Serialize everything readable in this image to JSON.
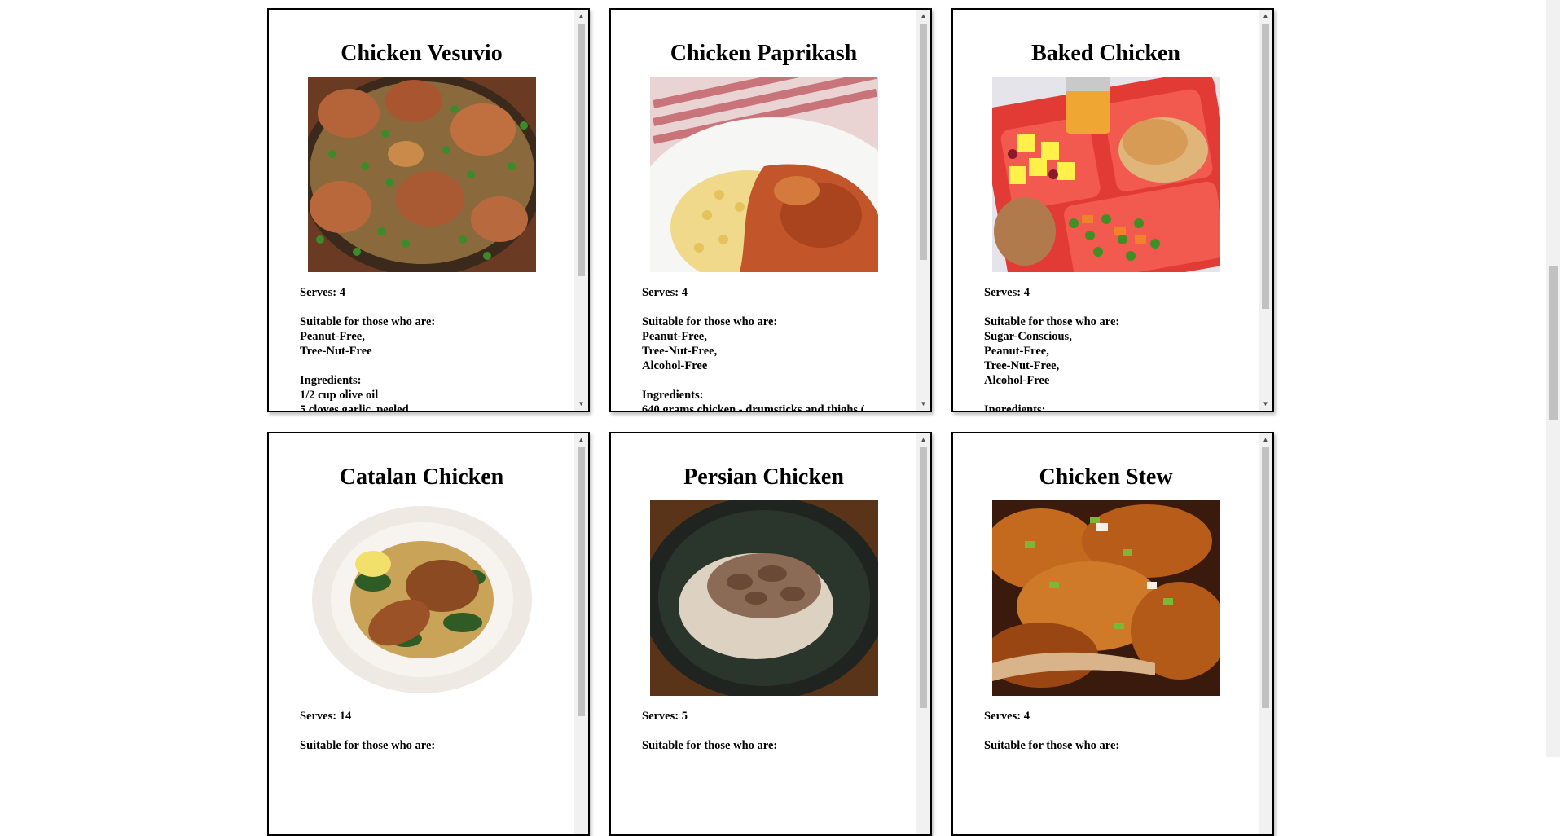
{
  "recipes": [
    {
      "title": "Chicken Vesuvio",
      "image_subject": "chicken-vesuvio-photo",
      "serves": "Serves: 4",
      "suitable_heading": "Suitable for those who are:",
      "suitable": [
        "Peanut-Free,",
        "Tree-Nut-Free"
      ],
      "ingredients_heading": "Ingredients:",
      "ingredients": [
        "1/2 cup olive oil",
        "5 cloves garlic, peeled"
      ]
    },
    {
      "title": "Chicken Paprikash",
      "image_subject": "chicken-paprikash-photo",
      "serves": "Serves: 4",
      "suitable_heading": "Suitable for those who are:",
      "suitable": [
        "Peanut-Free,",
        "Tree-Nut-Free,",
        "Alcohol-Free"
      ],
      "ingredients_heading": "Ingredients:",
      "ingredients": [
        "640 grams chicken - drumsticks and thighs ("
      ]
    },
    {
      "title": "Baked Chicken",
      "image_subject": "baked-chicken-tray-photo",
      "serves": "Serves: 4",
      "suitable_heading": "Suitable for those who are:",
      "suitable": [
        "Sugar-Conscious,",
        "Peanut-Free,",
        "Tree-Nut-Free,",
        "Alcohol-Free"
      ],
      "ingredients_heading": "Ingredients:",
      "ingredients": []
    },
    {
      "title": "Catalan Chicken",
      "image_subject": "catalan-chicken-photo",
      "serves": "Serves: 14",
      "suitable_heading": "Suitable for those who are:",
      "suitable": [],
      "ingredients_heading": "",
      "ingredients": []
    },
    {
      "title": "Persian Chicken",
      "image_subject": "persian-chicken-photo",
      "serves": "Serves: 5",
      "suitable_heading": "Suitable for those who are:",
      "suitable": [],
      "ingredients_heading": "",
      "ingredients": []
    },
    {
      "title": "Chicken Stew",
      "image_subject": "chicken-stew-photo",
      "serves": "Serves: 4",
      "suitable_heading": "Suitable for those who are:",
      "suitable": [],
      "ingredients_heading": "",
      "ingredients": []
    }
  ],
  "icons": {
    "scroll_up": "scroll-up-arrow-icon",
    "scroll_down": "scroll-down-arrow-icon"
  },
  "colors": {
    "card_border": "#000000",
    "scrollbar_track": "#f1f1f1",
    "scrollbar_thumb": "#c1c1c1"
  }
}
